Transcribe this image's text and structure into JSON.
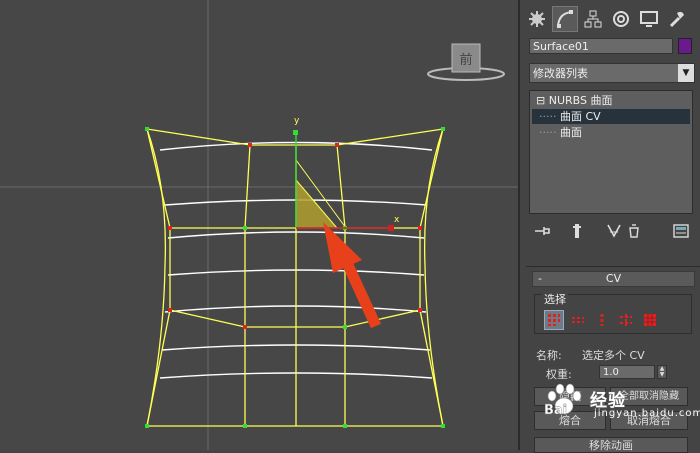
{
  "viewport": {
    "viewcube_label": "前",
    "axis_y_label": "y",
    "axis_x_label": "x"
  },
  "panel": {
    "tabs": [
      "create-icon",
      "modify-icon",
      "hierarchy-icon",
      "motion-icon",
      "display-icon",
      "utilities-icon"
    ],
    "object_name": "Surface01",
    "object_color": "#6a1a8a",
    "modifier_list": "修改器列表",
    "stack": [
      {
        "label": "NURBS 曲面",
        "prefix": "⊟"
      },
      {
        "label": "曲面 CV"
      },
      {
        "label": "曲面"
      }
    ],
    "stack_tools": [
      "pin-stack-icon",
      "show-end-result-icon",
      "make-unique-icon",
      "remove-modifier-icon",
      "configure-sets-icon"
    ]
  },
  "rollout": {
    "toggle": "-",
    "title": "CV",
    "selection_group": "选择",
    "selection_buttons": [
      "single-cv-icon",
      "row-u-icon",
      "row-v-icon",
      "row-uv-icon",
      "all-cvs-icon"
    ],
    "name_label": "名称:",
    "name_value": "选定多个 CV",
    "weight_label": "权重:",
    "weight_value": "1.0",
    "hide_button": "隐藏",
    "unhide_all_button": "全部取消隐藏",
    "fuse_button": "熔合",
    "unfuse_button": "取消熔合",
    "remove_anim_button": "移除动画"
  },
  "watermark": {
    "brand": "Bai",
    "text": "经验",
    "url": "jingyan.baidu.com"
  },
  "colors": {
    "wire": "#ffff55",
    "surface": "#ffffff",
    "cv_green": "#33dd33",
    "cv_red": "#dd2222",
    "annotation_arrow": "#e8401a",
    "selected_face": "#b0a030"
  }
}
